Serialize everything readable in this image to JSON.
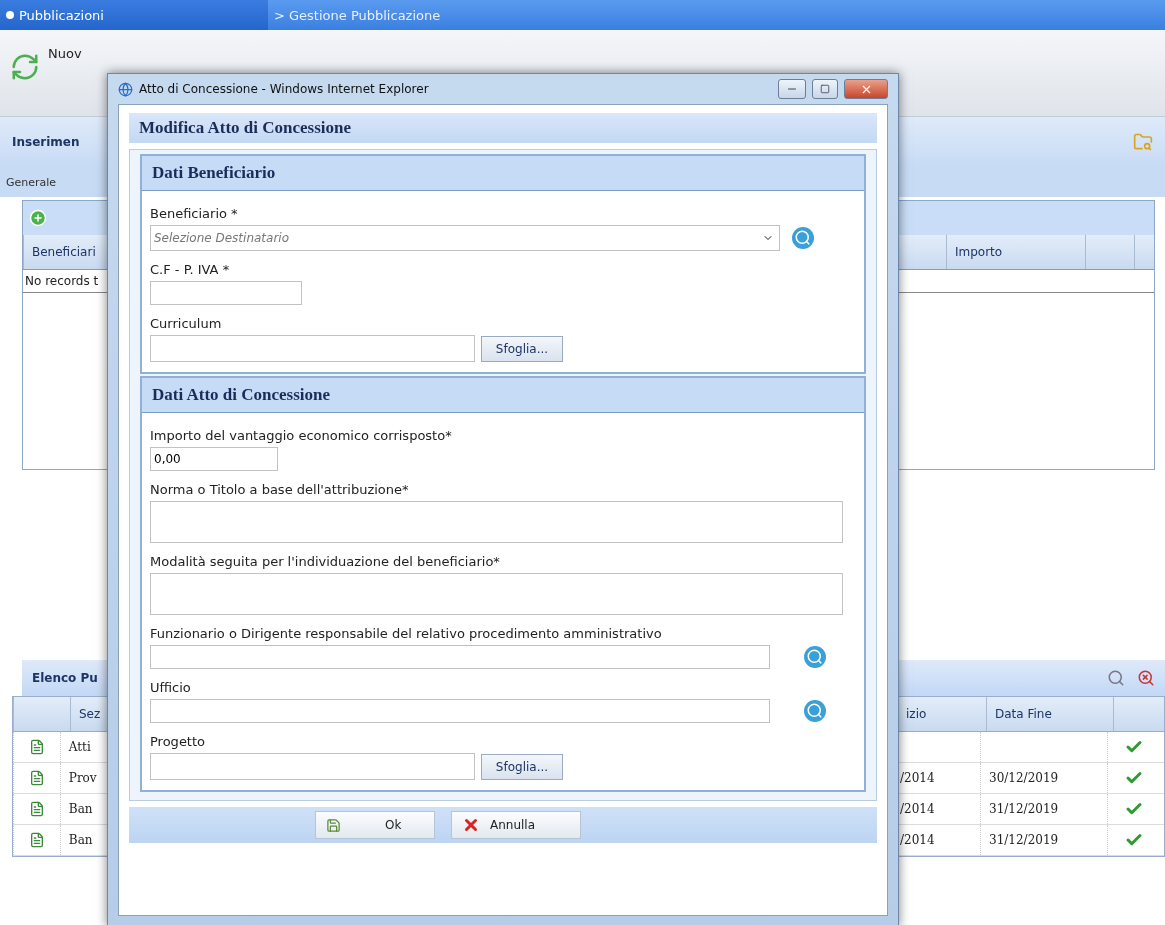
{
  "app_header": {
    "section": "Pubblicazioni",
    "breadcrumb": "> Gestione Pubblicazione"
  },
  "toolbar": {
    "items": [
      {
        "label": "Nuov"
      }
    ]
  },
  "insert_panel": {
    "title": "Inserimen",
    "tab": "Generale",
    "left_column": "Beneficiari",
    "right_column": "Importo",
    "empty_message": "No records t"
  },
  "list_panel": {
    "title": "Elenco Pu",
    "left_column": "Sez",
    "right_columns": [
      "izio",
      "Data Fine"
    ],
    "rows": [
      {
        "section": "Atti",
        "active": true
      },
      {
        "section": "Prov",
        "start": "/2014",
        "end": "30/12/2019",
        "active": true
      },
      {
        "section": "Ban",
        "start": "/2014",
        "end": "31/12/2019",
        "active": true
      },
      {
        "section": "Ban",
        "start": "/2014",
        "end": "31/12/2019",
        "active": true
      }
    ]
  },
  "dialog": {
    "window_title": "Atto di Concessione - Windows Internet Explorer",
    "heading": "Modifica Atto di Concessione",
    "sections": [
      {
        "title": "Dati Beneficiario",
        "fields": [
          {
            "kind": "combo",
            "label": "Beneficiario *",
            "placeholder": "Selezione Destinatario"
          },
          {
            "kind": "short",
            "label": "C.F - P. IVA *"
          },
          {
            "kind": "file",
            "label": "Curriculum",
            "button": "Sfoglia..."
          }
        ]
      },
      {
        "title": "Dati Atto di Concessione",
        "fields": [
          {
            "kind": "short",
            "label": "Importo del vantaggio economico corrisposto*",
            "value": "0,00"
          },
          {
            "kind": "textarea",
            "label": "Norma o Titolo a base dell'attribuzione*"
          },
          {
            "kind": "textarea",
            "label": "Modalità seguita per l'individuazione del beneficiario*"
          },
          {
            "kind": "lookup",
            "label": "Funzionario o Dirigente responsabile del relativo procedimento amministrativo"
          },
          {
            "kind": "lookup",
            "label": "Ufficio"
          },
          {
            "kind": "file",
            "label": "Progetto",
            "button": "Sfoglia..."
          }
        ]
      }
    ],
    "buttons": [
      {
        "kind": "ok",
        "label": "Ok"
      },
      {
        "kind": "cancel",
        "label": "Annulla"
      }
    ]
  }
}
